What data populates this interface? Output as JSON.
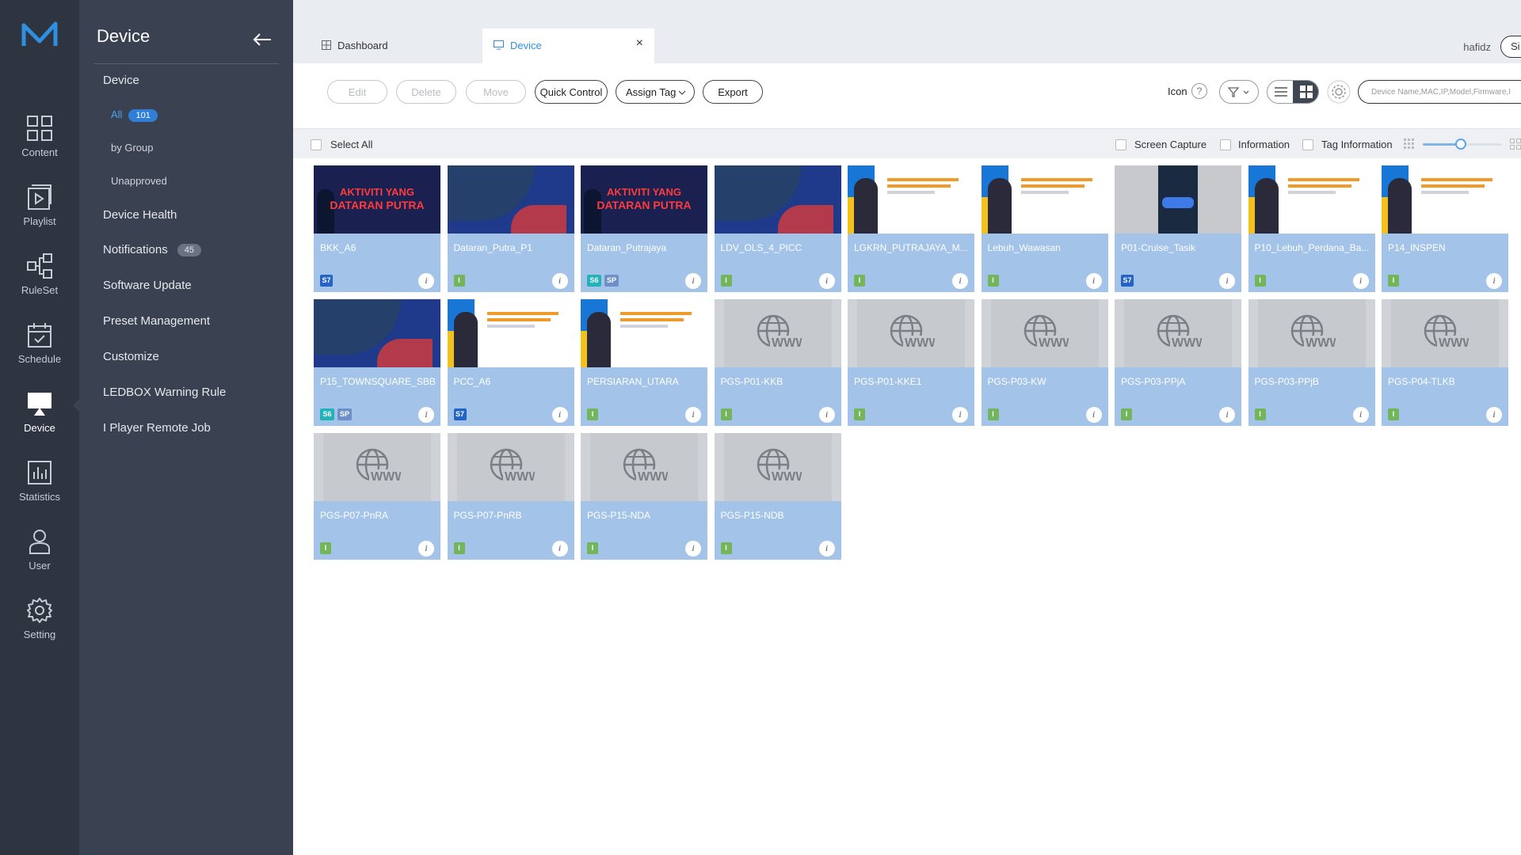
{
  "rail": {
    "items": [
      {
        "label": "Content",
        "icon": "content-icon"
      },
      {
        "label": "Playlist",
        "icon": "playlist-icon"
      },
      {
        "label": "RuleSet",
        "icon": "ruleset-icon"
      },
      {
        "label": "Schedule",
        "icon": "schedule-icon"
      },
      {
        "label": "Device",
        "icon": "device-icon",
        "active": true
      },
      {
        "label": "Statistics",
        "icon": "statistics-icon"
      },
      {
        "label": "User",
        "icon": "user-icon"
      },
      {
        "label": "Setting",
        "icon": "gear-icon"
      }
    ]
  },
  "sidebar": {
    "title": "Device",
    "items": [
      {
        "label": "Device"
      },
      {
        "label": "Device Health"
      },
      {
        "label": "Notifications",
        "count": "45"
      },
      {
        "label": "Software Update"
      },
      {
        "label": "Preset Management"
      },
      {
        "label": "Customize"
      },
      {
        "label": "LEDBOX Warning Rule"
      },
      {
        "label": "I Player Remote Job"
      }
    ],
    "sub_items": [
      {
        "label": "All",
        "count": "101",
        "active": true
      },
      {
        "label": "by Group"
      },
      {
        "label": "Unapproved"
      }
    ]
  },
  "tabs": {
    "dashboard": "Dashboard",
    "device": "Device",
    "close": "×"
  },
  "header": {
    "user": "hafidz",
    "sign": "Si"
  },
  "toolbar": {
    "edit": "Edit",
    "delete": "Delete",
    "move": "Move",
    "quick_control": "Quick Control",
    "assign_tag": "Assign Tag",
    "export": "Export",
    "icon_label": "Icon",
    "help": "?",
    "search_placeholder": "Device Name,MAC,IP,Model,Firmware,I"
  },
  "options": {
    "select_all": "Select All",
    "screen_capture": "Screen Capture",
    "information": "Information",
    "tag_information": "Tag Information",
    "thumbnail_size_level": 0.48
  },
  "devices": [
    {
      "name": "BKK_A6",
      "thumb": "poster",
      "badges": [
        "S7"
      ]
    },
    {
      "name": "Dataran_Putra_P1",
      "thumb": "map",
      "badges": [
        "I"
      ]
    },
    {
      "name": "Dataran_Putrajaya",
      "thumb": "poster",
      "badges": [
        "S6",
        "SP"
      ]
    },
    {
      "name": "LDV_OLS_4_PICC",
      "thumb": "map",
      "badges": [
        "I"
      ]
    },
    {
      "name": "LGKRN_PUTRAJAYA_M...",
      "thumb": "minister",
      "badges": [
        "I"
      ]
    },
    {
      "name": "Lebuh_Wawasan",
      "thumb": "minister",
      "badges": [
        "I"
      ]
    },
    {
      "name": "P01-Cruise_Tasik",
      "thumb": "dark",
      "badges": [
        "S7"
      ]
    },
    {
      "name": "P10_Lebuh_Perdana_Ba...",
      "thumb": "minister",
      "badges": [
        "I"
      ]
    },
    {
      "name": "P14_INSPEN",
      "thumb": "minister",
      "badges": [
        "I"
      ]
    },
    {
      "name": "P15_TOWNSQUARE_SBB",
      "thumb": "map",
      "badges": [
        "S6",
        "SP"
      ]
    },
    {
      "name": "PCC_A6",
      "thumb": "minister",
      "badges": [
        "S7"
      ]
    },
    {
      "name": "PERSIARAN_UTARA",
      "thumb": "minister",
      "badges": [
        "I"
      ]
    },
    {
      "name": "PGS-P01-KKB",
      "thumb": "www",
      "badges": [
        "I"
      ]
    },
    {
      "name": "PGS-P01-KKE1",
      "thumb": "www",
      "badges": [
        "I"
      ]
    },
    {
      "name": "PGS-P03-KW",
      "thumb": "www",
      "badges": [
        "I"
      ]
    },
    {
      "name": "PGS-P03-PPjA",
      "thumb": "www",
      "badges": [
        "I"
      ]
    },
    {
      "name": "PGS-P03-PPjB",
      "thumb": "www",
      "badges": [
        "I"
      ]
    },
    {
      "name": "PGS-P04-TLKB",
      "thumb": "www",
      "badges": [
        "I"
      ]
    },
    {
      "name": "PGS-P07-PnRA",
      "thumb": "www",
      "badges": [
        "I"
      ]
    },
    {
      "name": "PGS-P07-PnRB",
      "thumb": "www",
      "badges": [
        "I"
      ]
    },
    {
      "name": "PGS-P15-NDA",
      "thumb": "www",
      "badges": [
        "I"
      ]
    },
    {
      "name": "PGS-P15-NDB",
      "thumb": "www",
      "badges": [
        "I"
      ]
    }
  ],
  "thumb_text": {
    "poster_line1": "AKTIVITI YANG",
    "poster_line2": "DATARAN PUTRA"
  },
  "colors": {
    "rail_bg": "#2e3440",
    "sidebar_bg": "#3a4150",
    "accent": "#2f8fe0",
    "card_bg": "#a3c4e8",
    "badge_s7": "#2464c7",
    "badge_s6": "#22b3b8",
    "badge_sp": "#6f8fc8",
    "badge_i": "#72b55a"
  }
}
